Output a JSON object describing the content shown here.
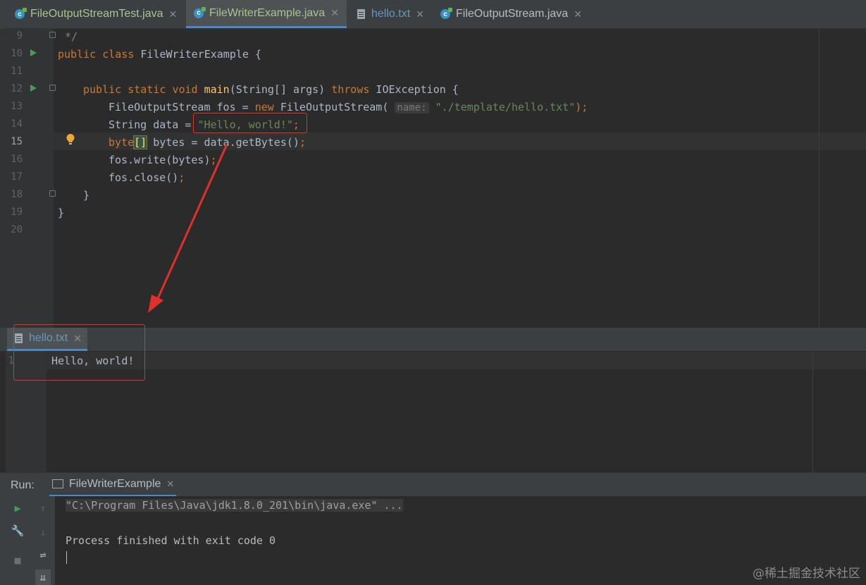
{
  "tabs": [
    {
      "label": "FileOutputStreamTest.java",
      "icon": "java-class-icon",
      "active": false
    },
    {
      "label": "FileWriterExample.java",
      "icon": "java-class-icon",
      "active": true
    },
    {
      "label": "hello.txt",
      "icon": "text-file-icon",
      "active": false
    },
    {
      "label": "FileOutputStream.java",
      "icon": "java-class-icon",
      "active": false
    }
  ],
  "editor": {
    "line_numbers": [
      "9",
      "10",
      "11",
      "12",
      "13",
      "14",
      "15",
      "16",
      "17",
      "18",
      "19",
      "20"
    ],
    "current_line": "15",
    "lines": {
      "l9": "*/",
      "l10_kw": "public class ",
      "l10_name": "FileWriterExample {",
      "l12_kw": "public static void ",
      "l12_fn": "main",
      "l12_params": "(String[] args) ",
      "l12_throws": "throws",
      "l12_exc": " IOException {",
      "l13_a": "FileOutputStream fos = ",
      "l13_new": "new",
      "l13_b": " FileOutputStream(",
      "l13_hint": "name:",
      "l13_str": "\"./template/hello.txt\"",
      "l13_end": ");",
      "l14_a": "String data = ",
      "l14_str": "\"Hello, world!\"",
      "l14_end": ";",
      "l15_kw": "byte",
      "l15_brk": "[]",
      "l15_rest": " bytes = data.getBytes()",
      "l15_end": ";",
      "l16_a": "fos.write(bytes)",
      "l16_end": ";",
      "l17_a": "fos.close()",
      "l17_end": ";",
      "l18": "}",
      "l19": "}"
    }
  },
  "hello_pane": {
    "tab_label": "hello.txt",
    "line_number": "1",
    "content": "Hello, world!"
  },
  "run_panel": {
    "label": "Run:",
    "config_name": "FileWriterExample",
    "console_lines": [
      "\"C:\\Program Files\\Java\\jdk1.8.0_201\\bin\\java.exe\" ...",
      "",
      "Process finished with exit code 0"
    ]
  },
  "watermark": "@稀土掘金技术社区",
  "colors": {
    "annotation_red": "#e0302a",
    "keyword": "#cc7832",
    "string": "#6a8759",
    "method": "#ffc66d"
  }
}
